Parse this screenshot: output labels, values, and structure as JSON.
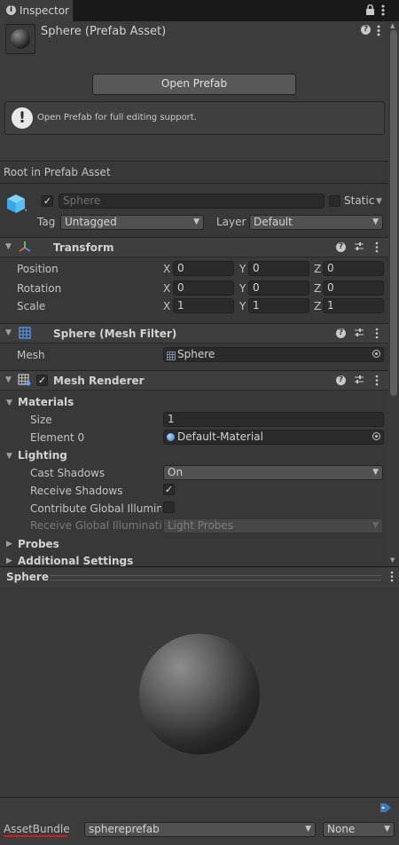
{
  "tab": {
    "title": "Inspector",
    "icon": "info-icon"
  },
  "tab_actions": {
    "lock_icon": "lock-icon",
    "menu_icon": "kebab-menu-icon"
  },
  "asset": {
    "title": "Sphere (Prefab Asset)",
    "open_prefab_label": "Open Prefab",
    "help_text": "Open Prefab for full editing support.",
    "root_label": "Root in Prefab Asset"
  },
  "gameobject": {
    "active": true,
    "name_placeholder": "Sphere",
    "static_label": "Static",
    "tag_label": "Tag",
    "tag_value": "Untagged",
    "layer_label": "Layer",
    "layer_value": "Default"
  },
  "transform": {
    "title": "Transform",
    "rows": [
      {
        "label": "Position",
        "x": "0",
        "y": "0",
        "z": "0"
      },
      {
        "label": "Rotation",
        "x": "0",
        "y": "0",
        "z": "0"
      },
      {
        "label": "Scale",
        "x": "1",
        "y": "1",
        "z": "1"
      }
    ],
    "axes": {
      "x": "X",
      "y": "Y",
      "z": "Z"
    }
  },
  "mesh_filter": {
    "title": "Sphere (Mesh Filter)",
    "mesh_label": "Mesh",
    "mesh_value": "Sphere"
  },
  "mesh_renderer": {
    "title": "Mesh Renderer",
    "enabled": true,
    "materials_label": "Materials",
    "size_label": "Size",
    "size_value": "1",
    "element0_label": "Element 0",
    "element0_value": "Default-Material",
    "lighting_label": "Lighting",
    "cast_shadows_label": "Cast Shadows",
    "cast_shadows_value": "On",
    "receive_shadows_label": "Receive Shadows",
    "receive_shadows": true,
    "contribute_gi_label": "Contribute Global Illuminat",
    "contribute_gi": false,
    "receive_gi_label": "Receive Global Illuminatio",
    "receive_gi_value": "Light Probes",
    "probes_label": "Probes",
    "additional_label": "Additional Settings"
  },
  "preview": {
    "title": "Sphere"
  },
  "asset_bundle": {
    "label": "AssetBundle",
    "name_value": "sphereprefab",
    "variant_value": "None"
  },
  "colors": {
    "accent": "#3a79bb",
    "underline": "#d11e1e",
    "panel": "#383838"
  }
}
